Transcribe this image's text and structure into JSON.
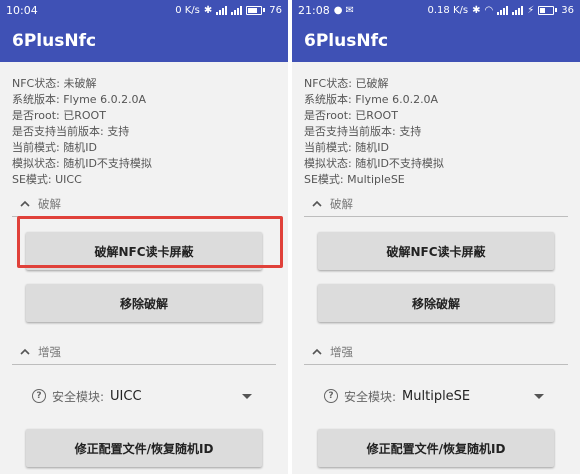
{
  "left": {
    "status": {
      "time": "10:04",
      "net_speed": "0 K/s",
      "battery": "76",
      "battery_level": 0.76
    },
    "app_title": "6PlusNfc",
    "info": [
      "NFC状态: 未破解",
      "系统版本: Flyme 6.0.2.0A",
      "是否root: 已ROOT",
      "是否支持当前版本: 支持",
      "当前模式: 随机ID",
      "模拟状态: 随机ID不支持模拟",
      "SE模式: UICC"
    ],
    "section_crack": "破解",
    "btn_crack": "破解NFC读卡屏蔽",
    "btn_remove": "移除破解",
    "section_enhance": "增强",
    "security_label": "安全模块:",
    "security_value": "UICC",
    "btn_fix": "修正配置文件/恢复随机ID"
  },
  "right": {
    "status": {
      "time": "21:08",
      "net_speed": "0.18 K/s",
      "battery": "36",
      "battery_level": 0.36
    },
    "app_title": "6PlusNfc",
    "info": [
      "NFC状态: 已破解",
      "系统版本: Flyme 6.0.2.0A",
      "是否root: 已ROOT",
      "是否支持当前版本: 支持",
      "当前模式: 随机ID",
      "模拟状态: 随机ID不支持模拟",
      "SE模式: MultipleSE"
    ],
    "section_crack": "破解",
    "btn_crack": "破解NFC读卡屏蔽",
    "btn_remove": "移除破解",
    "section_enhance": "增强",
    "security_label": "安全模块:",
    "security_value": "MultipleSE",
    "btn_fix": "修正配置文件/恢复随机ID"
  },
  "colors": {
    "primary": "#3f51b5",
    "highlight": "#e0413a",
    "button": "#dcdcdc"
  }
}
